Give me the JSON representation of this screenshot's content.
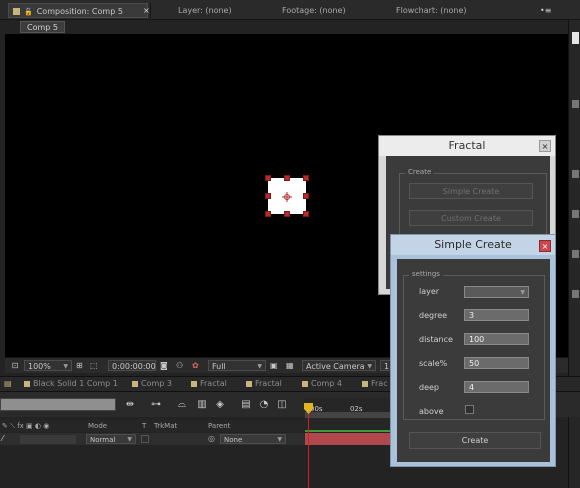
{
  "tabs": {
    "composition": "Composition: Comp 5",
    "layer": "Layer: (none)",
    "footage": "Footage: (none)",
    "flowchart": "Flowchart: (none)",
    "close_glyph": "×",
    "menu_glyph": "•≡"
  },
  "comp_name": "Comp 5",
  "viewer_bar": {
    "zoom": "100%",
    "timecode": "0:00:00:00",
    "resolution": "Full",
    "camera": "Active Camera",
    "views": "1"
  },
  "timeline_tabs": [
    "Black Solid 1 Comp 1",
    "Comp 3",
    "Fractal",
    "Fractal",
    "Comp 4",
    "Frac"
  ],
  "timeline": {
    "columns": {
      "mode": "Mode",
      "t": "T",
      "trkmat": "TrkMat",
      "parent": "Parent"
    },
    "layer": {
      "mode": "Normal",
      "parent": "None"
    },
    "ruler": {
      "start": "00s",
      "mark": "02s"
    }
  },
  "fractal_dialog": {
    "title": "Fractal",
    "group_label": "Create",
    "buttons": [
      "Simple Create",
      "Custom Create"
    ],
    "close_glyph": "×"
  },
  "simple_dialog": {
    "title": "Simple Create",
    "group_label": "settings",
    "close_glyph": "×",
    "fields": {
      "layer": {
        "label": "layer",
        "value": ""
      },
      "degree": {
        "label": "degree",
        "value": "3"
      },
      "distance": {
        "label": "distance",
        "value": "100"
      },
      "scale": {
        "label": "scale%",
        "value": "50"
      },
      "deep": {
        "label": "deep",
        "value": "4"
      },
      "above": {
        "label": "above",
        "checked": false
      }
    },
    "create_button": "Create"
  },
  "colors": {
    "accent_label": "#c9b47d",
    "handle": "#b8292b",
    "layer_bar": "#b2484d",
    "playhead": "#e0b622"
  }
}
